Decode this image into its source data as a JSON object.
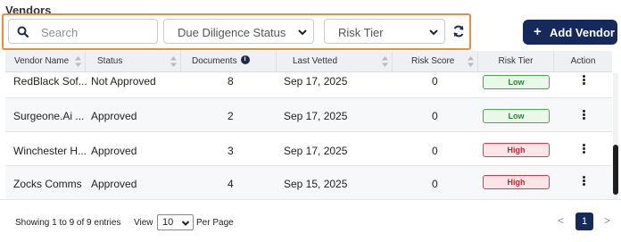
{
  "title": "Vendors",
  "search": {
    "placeholder": "Search"
  },
  "filters": {
    "due_diligence": "Due Diligence Status",
    "risk_tier": "Risk Tier"
  },
  "add_button": {
    "plus": "+",
    "label": "Add Vendor"
  },
  "columns": [
    "Vendor Name",
    "Status",
    "Documents",
    "Last Vetted",
    "Risk Score",
    "Risk Tier",
    "Action"
  ],
  "rows": [
    {
      "vendor": "RedBlack Sof...",
      "status": "Not Approved",
      "documents": "8",
      "last_vetted": "Sep 17, 2025",
      "risk_score": "0",
      "risk_tier": "Low"
    },
    {
      "vendor": "Surgeone.Ai ...",
      "status": "Approved",
      "documents": "2",
      "last_vetted": "Sep 17, 2025",
      "risk_score": "0",
      "risk_tier": "Low"
    },
    {
      "vendor": "Winchester H...",
      "status": "Approved",
      "documents": "3",
      "last_vetted": "Sep 17, 2025",
      "risk_score": "0",
      "risk_tier": "High"
    },
    {
      "vendor": "Zocks Comms",
      "status": "Approved",
      "documents": "4",
      "last_vetted": "Sep 15, 2025",
      "risk_score": "0",
      "risk_tier": "High"
    }
  ],
  "footer": {
    "entries": "Showing 1 to 9 of 9 entries",
    "view_label": "View",
    "per_page_value": "10",
    "per_page_label": "Per Page",
    "prev": "<",
    "current_page": "1",
    "next": ">"
  },
  "colors": {
    "brand": "#15295a",
    "accent_border": "#f0883e",
    "low": "#48a64d",
    "high": "#d93a48"
  }
}
